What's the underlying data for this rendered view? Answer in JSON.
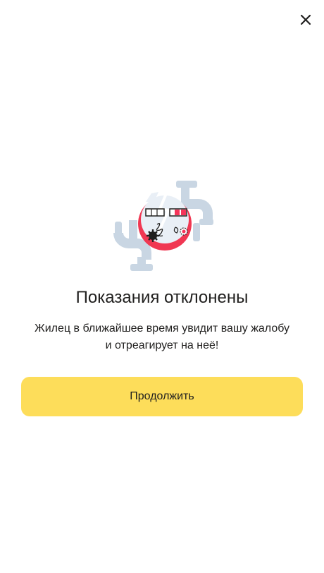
{
  "dialog": {
    "close_icon": "close-icon",
    "title": "Показания отклонены",
    "message_line1": "Жилец в ближайшее время увидит вашу жалобу",
    "message_line2": "и отреагирует на неё!",
    "continue_label": "Продолжить"
  },
  "illustration": {
    "name": "broken-meter-illustration",
    "colors": {
      "pipe": "#c9d6e3",
      "meter_red": "#f03752",
      "meter_face": "#e9eff6",
      "ink": "#21201f",
      "accent_red": "#f5355a"
    }
  },
  "colors": {
    "button": "#fddd5a",
    "text": "#21201f",
    "background": "#ffffff"
  }
}
